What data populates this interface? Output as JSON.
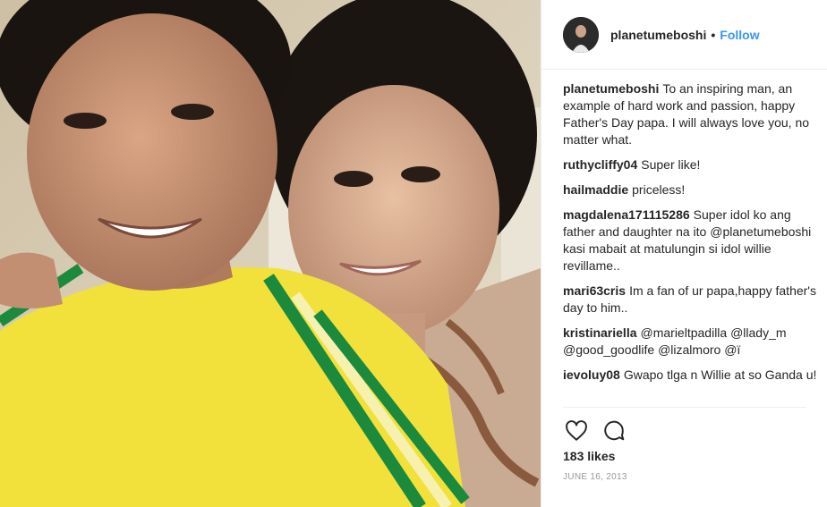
{
  "header": {
    "username": "planetumeboshi",
    "separator": "•",
    "follow_label": "Follow"
  },
  "comments": [
    {
      "author": "planetumeboshi",
      "text": "To an inspiring man, an example of hard work and passion, happy Father's Day papa. I will always love you, no matter what."
    },
    {
      "author": "ruthycliffy04",
      "text": "Super like!"
    },
    {
      "author": "hailmaddie",
      "text": "priceless!"
    },
    {
      "author": "magdalena171115286",
      "text": "Super idol ko ang father and daughter na ito @planetumeboshi kasi mabait at matulungin si idol willie revillame.."
    },
    {
      "author": "mari63cris",
      "text": "Im a fan of ur papa,happy father's day to him.."
    },
    {
      "author": "kristinariella",
      "text": "@marieltpadilla @llady_m @good_goodlife @lizalmoro @ï"
    },
    {
      "author": "ievoluy08",
      "text": "Gwapo tlga n Willie at so Ganda u!"
    }
  ],
  "actions": {
    "like_icon": "heart-icon",
    "comment_icon": "speech-bubble-icon"
  },
  "likes": "183 likes",
  "date": "JUNE 16, 2013",
  "colors": {
    "follow": "#3897f0",
    "text": "#262626",
    "muted": "#999999",
    "border": "#efefef"
  }
}
